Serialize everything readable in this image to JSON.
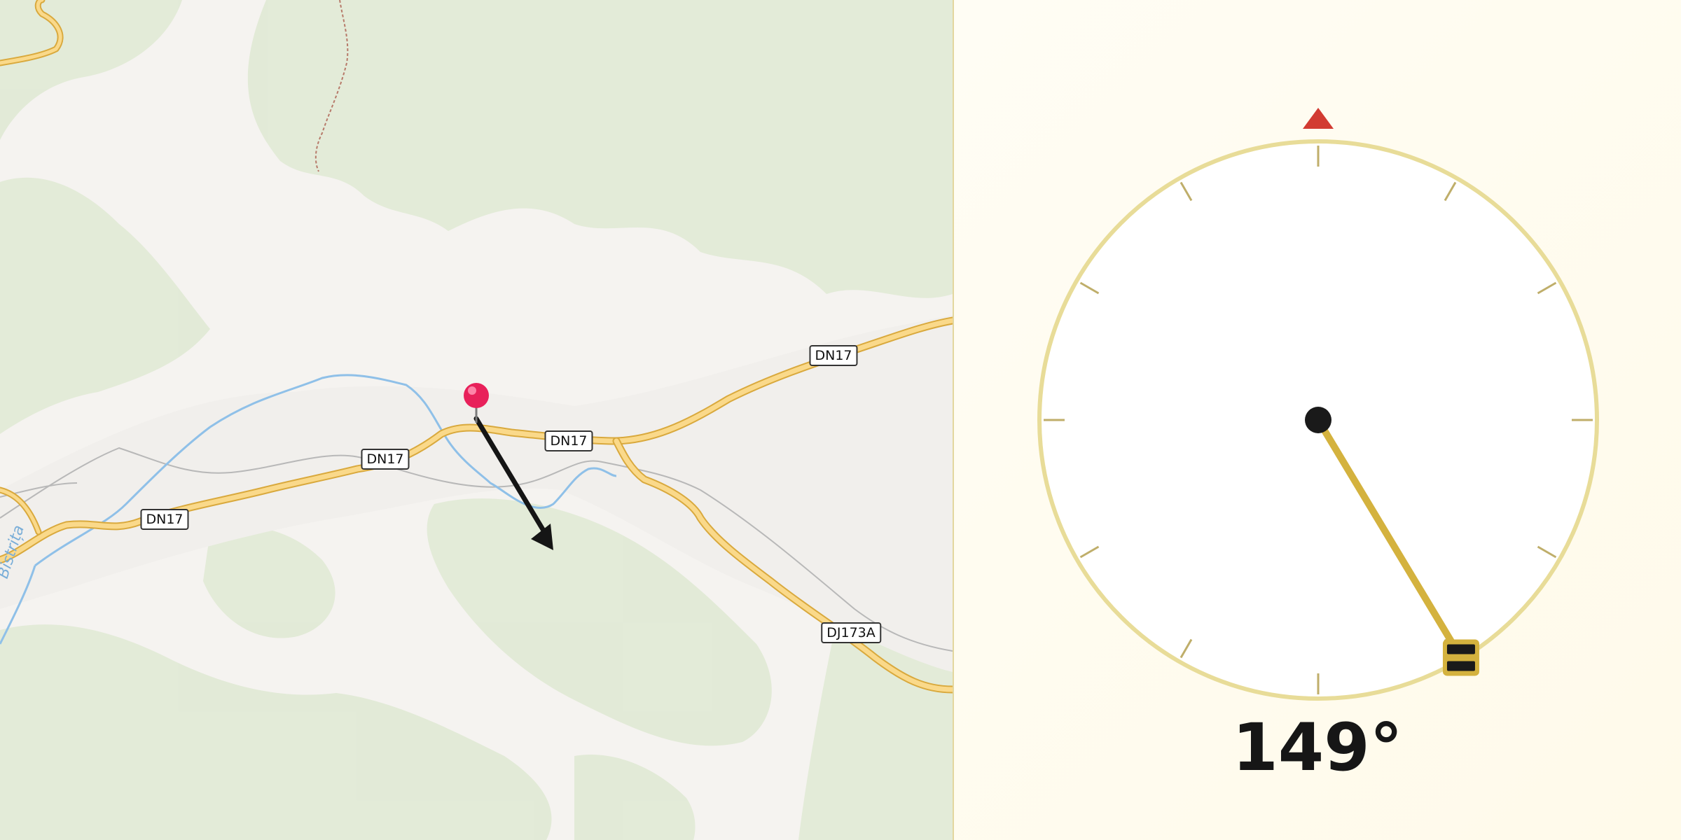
{
  "map": {
    "road_labels": [
      "DN17",
      "DN17",
      "DN17",
      "DN17",
      "DJ173A"
    ],
    "river_label": "Bistrița",
    "marker": "red-map-pin",
    "direction_arrow": "bearing-arrow"
  },
  "compass": {
    "heading_degrees": 149,
    "heading_text": "149°",
    "north_indicator": "red-triangle",
    "colors": {
      "ring": "#e8dc98",
      "needle": "#d4b23e",
      "north": "#d23b32",
      "handle": "#1a1a1a"
    }
  }
}
